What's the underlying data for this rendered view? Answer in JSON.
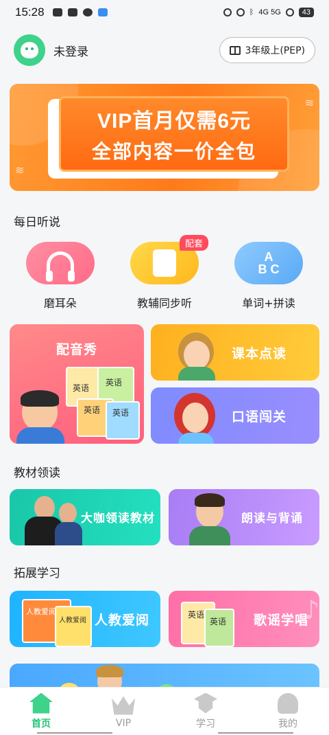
{
  "status_bar": {
    "time": "15:28",
    "network_text": "4G 5G",
    "battery": "43"
  },
  "header": {
    "login_label": "未登录",
    "grade_label": "3年级上(PEP)"
  },
  "vip_banner": {
    "line1": "VIP首月仅需6元",
    "line2": "全部内容一价全包"
  },
  "sections": {
    "daily_listen": "每日听说",
    "textbook_read": "教材领读",
    "extended_learning": "拓展学习"
  },
  "daily_items": [
    {
      "label": "磨耳朵",
      "badge": ""
    },
    {
      "label": "教辅同步听",
      "badge": "配套"
    },
    {
      "label": "单词+拼读",
      "badge": ""
    }
  ],
  "feature_cards": {
    "dubbing": "配音秀",
    "textbook_reading": "课本点读",
    "oral_challenge": "口语闯关",
    "expert_reading": "大咖领读教材",
    "recite": "朗读与背诵",
    "pep_reading": "人教爱阅",
    "songs": "歌谣学唱"
  },
  "book_text": {
    "english": "英语",
    "pep_love_read": "人教爱阅"
  },
  "tabs": [
    {
      "label": "首页",
      "icon": "home-icon",
      "active": true
    },
    {
      "label": "VIP",
      "icon": "crown-icon",
      "active": false
    },
    {
      "label": "学习",
      "icon": "graduation-cap-icon",
      "active": false
    },
    {
      "label": "我的",
      "icon": "user-icon",
      "active": false
    }
  ],
  "colors": {
    "accent_green": "#28c47a",
    "vip_orange": "#ff7a1a",
    "badge_red": "#ff4b5c"
  }
}
